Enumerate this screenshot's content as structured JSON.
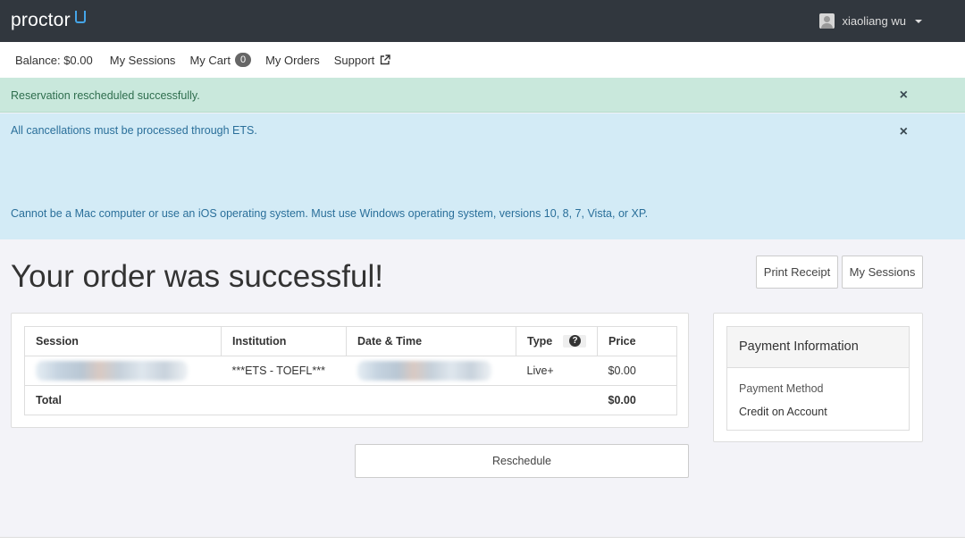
{
  "brand": {
    "logo": "proctor"
  },
  "user": {
    "name": "xiaoliang wu"
  },
  "nav": {
    "balance": "Balance: $0.00",
    "sessions": "My Sessions",
    "cart": "My Cart",
    "cart_count": "0",
    "orders": "My Orders",
    "support": "Support"
  },
  "alerts": {
    "success": "Reservation rescheduled successfully.",
    "info_line1": "All cancellations must be processed through ETS.",
    "info_line2": "Cannot be a Mac computer or use an iOS operating system. Must use Windows operating system, versions 10, 8, 7, Vista, or XP.",
    "close": "×"
  },
  "page": {
    "title": "Your order was successful!",
    "print_receipt": "Print Receipt",
    "my_sessions": "My Sessions",
    "reschedule": "Reschedule"
  },
  "order": {
    "headers": [
      "Session",
      "Institution",
      "Date & Time",
      "Type",
      "Price"
    ],
    "row": {
      "session_prefix": "TEL",
      "institution": "***ETS - TOEFL***",
      "type": "Live+",
      "price": "$0.00"
    },
    "total_label": "Total",
    "total_value": "$0.00"
  },
  "payment": {
    "title": "Payment Information",
    "method_label": "Payment Method",
    "method_value": "Credit on Account"
  },
  "colors": {
    "topbar": "#31373e",
    "success_bg": "#c9e8dc",
    "info_bg": "#d3ebf6",
    "accent": "#45a5e8"
  }
}
